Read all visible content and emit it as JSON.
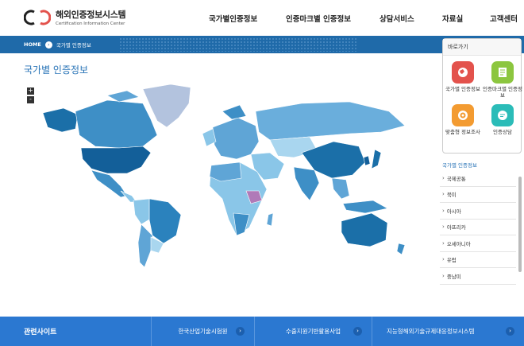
{
  "logo": {
    "title": "해외인증정보시스템",
    "subtitle": "Certification Information Center"
  },
  "nav": [
    {
      "label": "국가별인증정보"
    },
    {
      "label": "인증마크별 인증정보"
    },
    {
      "label": "상담서비스"
    },
    {
      "label": "자료실"
    },
    {
      "label": "고객센터"
    }
  ],
  "breadcrumb": {
    "home": "HOME",
    "separator_icon": "chevron-right-icon",
    "current": "국가별 인증정보"
  },
  "page": {
    "title": "국가별 인증정보"
  },
  "zoom": {
    "in": "+",
    "out": "-"
  },
  "quick_links": {
    "title": "바로가기",
    "items": [
      {
        "label": "국가별 인증정보",
        "icon": "globe-icon",
        "color": "#e3524c"
      },
      {
        "label": "인증마크별 인증정보",
        "icon": "document-icon",
        "color": "#8cc63f"
      },
      {
        "label": "맞춤형 정보조사",
        "icon": "target-icon",
        "color": "#f39b31"
      },
      {
        "label": "인증상담",
        "icon": "chat-icon",
        "color": "#2bbcb8"
      }
    ]
  },
  "country_list": {
    "title": "국가별 인증정보",
    "items": [
      "국제공통",
      "북미",
      "아시아",
      "아프리카",
      "오세아니아",
      "유럽",
      "중남미"
    ]
  },
  "footer": {
    "title": "관련사이트",
    "links": [
      {
        "label": "한국산업기술시험원"
      },
      {
        "label": "수출지원기반활용사업"
      },
      {
        "label": "지능형해외기술규제대응정보시스템"
      }
    ]
  },
  "colors": {
    "primary": "#1f6aa9",
    "footer": "#2b78d1",
    "map_dark": "#1b6fa8",
    "map_light": "#8ac6e8",
    "greenland": "#b3c3de"
  }
}
